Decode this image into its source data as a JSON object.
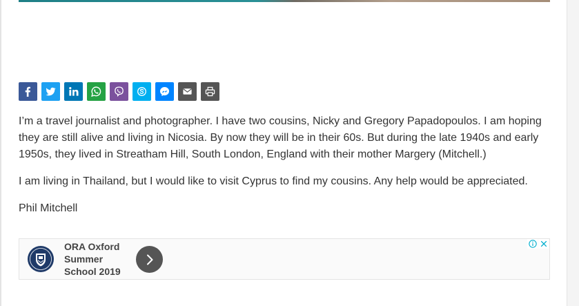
{
  "colors": {
    "facebook": "#3b5998",
    "twitter": "#1da1f2",
    "linkedin": "#0077b5",
    "whatsapp": "#25a244",
    "viber": "#7b519d",
    "skype": "#00aff0",
    "messenger": "#0084ff",
    "email": "#555555",
    "print": "#555555"
  },
  "share": {
    "buttons": [
      {
        "icon": "facebook-icon"
      },
      {
        "icon": "twitter-icon"
      },
      {
        "icon": "linkedin-icon"
      },
      {
        "icon": "whatsapp-icon"
      },
      {
        "icon": "viber-icon"
      },
      {
        "icon": "skype-icon"
      },
      {
        "icon": "messenger-icon"
      },
      {
        "icon": "email-icon"
      },
      {
        "icon": "print-icon"
      }
    ]
  },
  "article": {
    "paragraphs": [
      "I’m a travel journalist and photographer. I have two cousins, Nicky and Gregory Papadopoulos. I am hoping they are still alive and living in Nicosia. By now they will be in their 60s. But during the late 1940s and early 1950s, they lived in Streatham Hill, South London, England with their mother Margery (Mitchell.)",
      "I am living in Thailand, but I would like to visit Cyprus to find my cousins. Any help would be appreciated.",
      "Phil Mitchell"
    ]
  },
  "ad": {
    "title": "ORA Oxford Summer School 2019",
    "logo_icon": "school-crest-icon",
    "arrow_icon": "chevron-right-icon",
    "info_icon": "adchoices-info-icon",
    "close_icon": "close-icon"
  }
}
